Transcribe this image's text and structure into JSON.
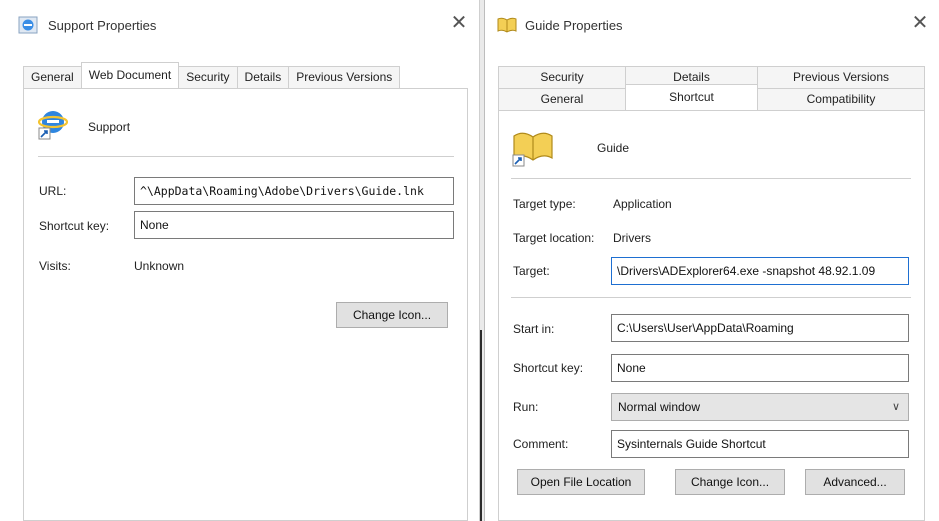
{
  "left_window": {
    "title": "Support Properties",
    "close_glyph": "✕",
    "tabs": [
      {
        "label": "General",
        "active": false
      },
      {
        "label": "Web Document",
        "active": true
      },
      {
        "label": "Security",
        "active": false
      },
      {
        "label": "Details",
        "active": false
      },
      {
        "label": "Previous Versions",
        "active": false
      }
    ],
    "item_name": "Support",
    "item_icon": "internet-shortcut-icon",
    "url_label": "URL:",
    "url_value": "^\\AppData\\Roaming\\Adobe\\Drivers\\Guide.lnk",
    "shortcut_key_label": "Shortcut key:",
    "shortcut_key_value": "None",
    "visits_label": "Visits:",
    "visits_value": "Unknown",
    "change_icon_label": "Change Icon..."
  },
  "right_window": {
    "title": "Guide Properties",
    "close_glyph": "✕",
    "tabs_top": [
      {
        "label": "Security"
      },
      {
        "label": "Details"
      },
      {
        "label": "Previous Versions"
      }
    ],
    "tabs_bottom": [
      {
        "label": "General",
        "active": false
      },
      {
        "label": "Shortcut",
        "active": true
      },
      {
        "label": "Compatibility",
        "active": false
      }
    ],
    "item_name": "Guide",
    "item_icon": "open-book-shortcut-icon",
    "target_type_label": "Target type:",
    "target_type_value": "Application",
    "target_location_label": "Target location:",
    "target_location_value": "Drivers",
    "target_label": "Target:",
    "target_value": "\\Drivers\\ADExplorer64.exe -snapshot 48.92.1.09",
    "start_in_label": "Start in:",
    "start_in_value": "C:\\Users\\User\\AppData\\Roaming",
    "shortcut_key_label": "Shortcut key:",
    "shortcut_key_value": "None",
    "run_label": "Run:",
    "run_value": "Normal window",
    "comment_label": "Comment:",
    "comment_value": "Sysinternals Guide Shortcut",
    "open_file_location_label": "Open File Location",
    "change_icon_label": "Change Icon...",
    "advanced_label": "Advanced..."
  },
  "colors": {
    "window_bg": "#ffffff",
    "field_focus_border": "#1e6fd1",
    "button_bg": "#e1e1e1"
  }
}
